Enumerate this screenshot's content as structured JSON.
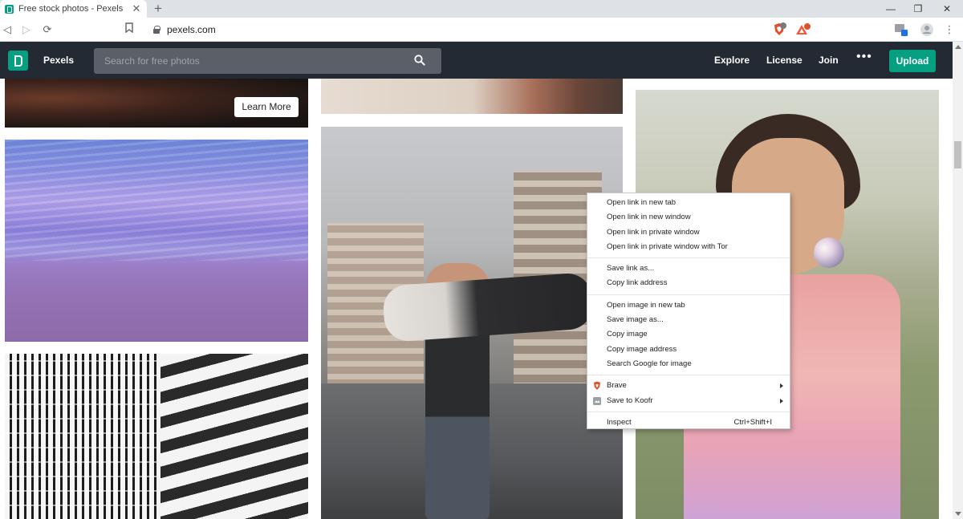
{
  "browser": {
    "tab_title": "Free stock photos - Pexels",
    "tab_close": "✕",
    "new_tab": "+",
    "url": "pexels.com",
    "window_controls": {
      "minimize": "—",
      "maximize": "❐",
      "close": "✕"
    },
    "nav": {
      "back": "◁",
      "forward": "▷",
      "reload": "⟳",
      "menu": "⋮"
    },
    "extension_badges": {
      "brave_shields_count": "3",
      "rewards_count": "1",
      "ext_count": "1"
    }
  },
  "header": {
    "brand": "Pexels",
    "search_placeholder": "Search for free photos",
    "nav": [
      "Explore",
      "License",
      "Join"
    ],
    "more": "•••",
    "upload": "Upload"
  },
  "photos": {
    "promo_button": "Learn More"
  },
  "context_menu": {
    "groups": [
      [
        "Open link in new tab",
        "Open link in new window",
        "Open link in private window",
        "Open link in private window with Tor"
      ],
      [
        "Save link as...",
        "Copy link address"
      ],
      [
        "Open image in new tab",
        "Save image as...",
        "Copy image",
        "Copy image address",
        "Search Google for image"
      ],
      [
        "Brave",
        "Save to Koofr"
      ],
      [
        "Inspect"
      ]
    ],
    "inspect_shortcut": "Ctrl+Shift+I"
  },
  "colors": {
    "pexels_green": "#05a081",
    "header_bg": "#232a34",
    "brave_orange": "#e2502b"
  }
}
